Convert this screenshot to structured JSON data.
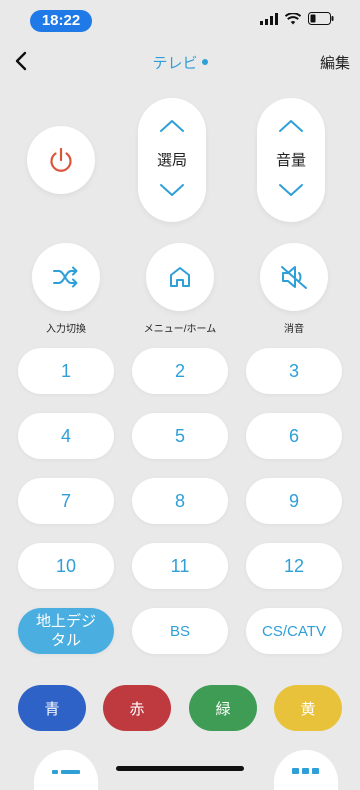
{
  "status_bar": {
    "time": "18:22",
    "icons": [
      "signal-icon",
      "wifi-icon",
      "battery-icon"
    ]
  },
  "nav": {
    "back_icon": "chevron-left-icon",
    "title": "テレビ",
    "edit_label": "編集"
  },
  "remote": {
    "power_icon": "power-icon",
    "channel_label": "選局",
    "volume_label": "音量",
    "input_label": "入力切換",
    "menu_label": "メニュー/ホーム",
    "mute_label": "消音",
    "number_keys": [
      "1",
      "2",
      "3",
      "4",
      "5",
      "6",
      "7",
      "8",
      "9",
      "10",
      "11",
      "12"
    ],
    "broadcast": {
      "terrestrial": "地上デジタル",
      "bs": "BS",
      "cs": "CS/CATV"
    },
    "colors": {
      "blue": "青",
      "red": "赤",
      "green": "緑",
      "yellow": "黄",
      "blue_hex": "#2f62c6",
      "red_hex": "#bf3a3f",
      "green_hex": "#3e9c55",
      "yellow_hex": "#e7c23a"
    }
  },
  "theme": {
    "accent": "#2f9fd8",
    "power": "#d9553a",
    "background": "#e9e9e9"
  }
}
